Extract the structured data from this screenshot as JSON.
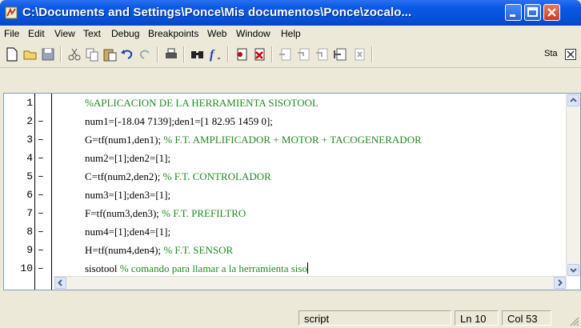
{
  "window": {
    "title": "C:\\Documents and Settings\\Ponce\\Mis documentos\\Ponce\\zocalo..."
  },
  "menu": [
    "File",
    "Edit",
    "View",
    "Text",
    "Debug",
    "Breakpoints",
    "Web",
    "Window",
    "Help"
  ],
  "toolbar": {
    "stack_label": "Sta",
    "icons": [
      "new-file-icon",
      "open-folder-icon",
      "save-icon",
      "cut-icon",
      "copy-icon",
      "paste-icon",
      "undo-icon",
      "redo-icon",
      "print-icon",
      "find-icon",
      "function-icon",
      "set-breakpoint-icon",
      "clear-breakpoint-icon",
      "step-icon",
      "step-in-icon",
      "step-out-icon",
      "continue-icon",
      "exit-debug-icon"
    ]
  },
  "editor": {
    "lines": [
      {
        "num": "1",
        "dash": "",
        "code": "",
        "comment": "%APLICACION DE LA HERRAMIENTA SISOTOOL"
      },
      {
        "num": "2",
        "dash": "–",
        "code": "num1=[-18.04 7139];den1=[1 82.95 1459 0];",
        "comment": ""
      },
      {
        "num": "3",
        "dash": "–",
        "code": "G=tf(num1,den1); ",
        "comment": "% F.T. AMPLIFICADOR + MOTOR + TACOGENERADOR"
      },
      {
        "num": "4",
        "dash": "–",
        "code": "num2=[1];den2=[1];",
        "comment": ""
      },
      {
        "num": "5",
        "dash": "–",
        "code": "C=tf(num2,den2); ",
        "comment": "% F.T. CONTROLADOR"
      },
      {
        "num": "6",
        "dash": "–",
        "code": "num3=[1];den3=[1];",
        "comment": ""
      },
      {
        "num": "7",
        "dash": "–",
        "code": "F=tf(num3,den3); ",
        "comment": "% F.T. PREFILTRO"
      },
      {
        "num": "8",
        "dash": "–",
        "code": "num4=[1];den4=[1];",
        "comment": ""
      },
      {
        "num": "9",
        "dash": "–",
        "code": "H=tf(num4,den4); ",
        "comment": "% F.T. SENSOR"
      },
      {
        "num": "10",
        "dash": "–",
        "code": "sisotool ",
        "comment": "% comando para llamar a la herramienta siso"
      }
    ]
  },
  "status": {
    "mode": "script",
    "line": "Ln 10",
    "col": "Col 53"
  },
  "colors": {
    "titlebar": "#0453d8",
    "comment": "#228b22",
    "chrome": "#ece9d8"
  }
}
